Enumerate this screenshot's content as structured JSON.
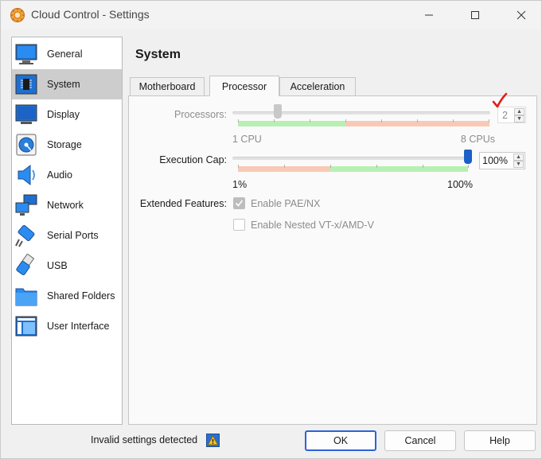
{
  "window": {
    "title": "Cloud Control - Settings",
    "controls": [
      "minimize",
      "maximize",
      "close"
    ]
  },
  "sidebar": {
    "selected": "System",
    "items": [
      {
        "label": "General",
        "icon": "monitor-icon"
      },
      {
        "label": "System",
        "icon": "chip-icon"
      },
      {
        "label": "Display",
        "icon": "display-icon"
      },
      {
        "label": "Storage",
        "icon": "disk-icon"
      },
      {
        "label": "Audio",
        "icon": "speaker-icon"
      },
      {
        "label": "Network",
        "icon": "network-icon"
      },
      {
        "label": "Serial Ports",
        "icon": "serial-port-icon"
      },
      {
        "label": "USB",
        "icon": "usb-icon"
      },
      {
        "label": "Shared Folders",
        "icon": "folder-icon"
      },
      {
        "label": "User Interface",
        "icon": "ui-layout-icon"
      }
    ]
  },
  "main": {
    "title": "System",
    "tabs": [
      {
        "label": "Motherboard",
        "active": false
      },
      {
        "label": "Processor",
        "active": true
      },
      {
        "label": "Acceleration",
        "active": false
      }
    ]
  },
  "processor": {
    "processors_label": "Processors:",
    "processors_value": "2",
    "processors_min_label": "1 CPU",
    "processors_max_label": "8 CPUs",
    "processors_level": 0.16,
    "processors_enabled": false,
    "execution_cap_label": "Execution Cap:",
    "execution_cap_value": "100%",
    "execution_cap_min_label": "1%",
    "execution_cap_max_label": "100%",
    "execution_cap_level": 1.0,
    "extended_features_label": "Extended Features:",
    "enable_pae_label": "Enable PAE/NX",
    "enable_pae_checked": true,
    "enable_nested_label": "Enable Nested VT-x/AMD-V",
    "enable_nested_checked": false
  },
  "annotation": {
    "checkmark_color": "#e0201b"
  },
  "footer": {
    "status": "Invalid settings detected",
    "ok_label": "OK",
    "cancel_label": "Cancel",
    "help_label": "Help"
  },
  "colors": {
    "accent": "#2d62d8",
    "slider_blue": "#1c5fc7",
    "range_green": "#b7f0b3",
    "range_orange": "#f8c9b5",
    "selected_item": "#cdcdcd"
  }
}
